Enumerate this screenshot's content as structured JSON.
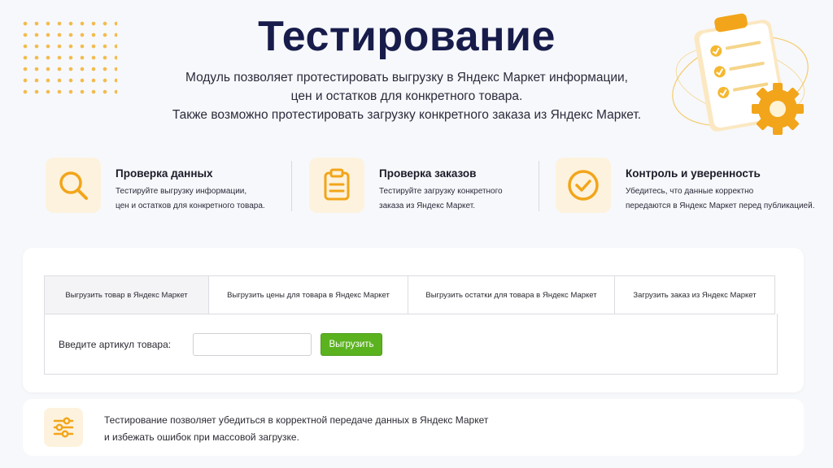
{
  "hero": {
    "title": "Тестирование",
    "line1": "Модуль позволяет протестировать выгрузку в Яндекс Маркет информации,",
    "line2": "цен и остатков для конкретного товара.",
    "line3": "Также возможно протестировать загрузку конкретного заказа из Яндекс Маркет."
  },
  "features": [
    {
      "icon": "search-icon",
      "title": "Проверка данных",
      "desc1": "Тестируйте выгрузку информации,",
      "desc2": "цен и остатков для конкретного товара."
    },
    {
      "icon": "clipboard-icon",
      "title": "Проверка заказов",
      "desc1": "Тестируйте загрузку конкретного",
      "desc2": "заказа из Яндекс Маркет."
    },
    {
      "icon": "check-circle-icon",
      "title": "Контроль и уверенность",
      "desc1": "Убедитесь, что данные корректно",
      "desc2": "передаются в Яндекс Маркет перед публикацией."
    }
  ],
  "tabs": [
    {
      "label": "Выгрузить товар в Яндекс Маркет",
      "active": true
    },
    {
      "label": "Выгрузить цены для товара в Яндекс Маркет",
      "active": false
    },
    {
      "label": "Выгрузить остатки для товара в Яндекс Маркет",
      "active": false
    },
    {
      "label": "Загрузить заказ из Яндекс Маркет",
      "active": false
    }
  ],
  "form": {
    "label": "Введите артикул товара:",
    "value": "",
    "button": "Выгрузить"
  },
  "note": {
    "icon": "sliders-icon",
    "line1": "Тестирование позволяет убедиться в корректной передаче данных в Яндекс Маркет",
    "line2": "и избежать ошибок при массовой загрузке."
  },
  "colors": {
    "accent": "#f2a51a",
    "title": "#171c4b",
    "button": "#5bb21f"
  }
}
